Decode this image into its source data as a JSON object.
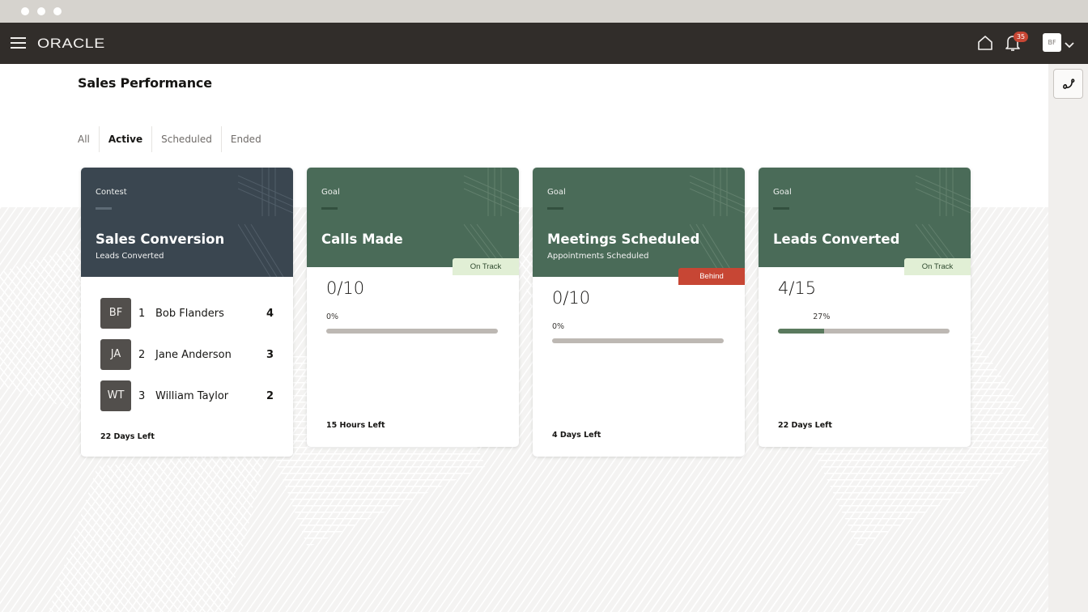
{
  "window": {
    "dots": 3
  },
  "topnav": {
    "brand": "ORACLE",
    "notifications_count": "35",
    "user_initials": "BF"
  },
  "page": {
    "title": "Sales Performance",
    "tabs": [
      {
        "label": "All",
        "active": false
      },
      {
        "label": "Active",
        "active": true
      },
      {
        "label": "Scheduled",
        "active": false
      },
      {
        "label": "Ended",
        "active": false
      }
    ]
  },
  "colors": {
    "contest_header": "#3a4650",
    "goal_header": "#4a6b58",
    "on_track_bg": "#e1efd5",
    "behind_bg": "#c74634",
    "progress_fill": "#5a7a5e",
    "progress_track": "#bdb8b3"
  },
  "cards": [
    {
      "type": "Contest",
      "title": "Sales Conversion",
      "subtitle": "Leads Converted",
      "leaderboard": [
        {
          "initials": "BF",
          "rank": "1",
          "name": "Bob Flanders",
          "score": "4"
        },
        {
          "initials": "JA",
          "rank": "2",
          "name": "Jane Anderson",
          "score": "3"
        },
        {
          "initials": "WT",
          "rank": "3",
          "name": "William Taylor",
          "score": "2"
        }
      ],
      "time_left": "22 Days Left"
    },
    {
      "type": "Goal",
      "title": "Calls Made",
      "status": "On Track",
      "value": "0/10",
      "percent_label": "0%",
      "progress": 0,
      "time_left": "15 Hours Left"
    },
    {
      "type": "Goal",
      "title": "Meetings Scheduled",
      "subtitle": "Appointments Scheduled",
      "status": "Behind",
      "value": "0/10",
      "percent_label": "0%",
      "progress": 0,
      "time_left": "4 Days Left"
    },
    {
      "type": "Goal",
      "title": "Leads Converted",
      "status": "On Track",
      "value": "4/15",
      "percent_label": "27%",
      "progress": 27,
      "time_left": "22 Days Left"
    }
  ],
  "icons": {
    "menu": "hamburger-menu-icon",
    "home": "home-icon",
    "notifications": "bell-icon",
    "user_menu": "chevron-down-icon",
    "call": "phone-icon"
  }
}
